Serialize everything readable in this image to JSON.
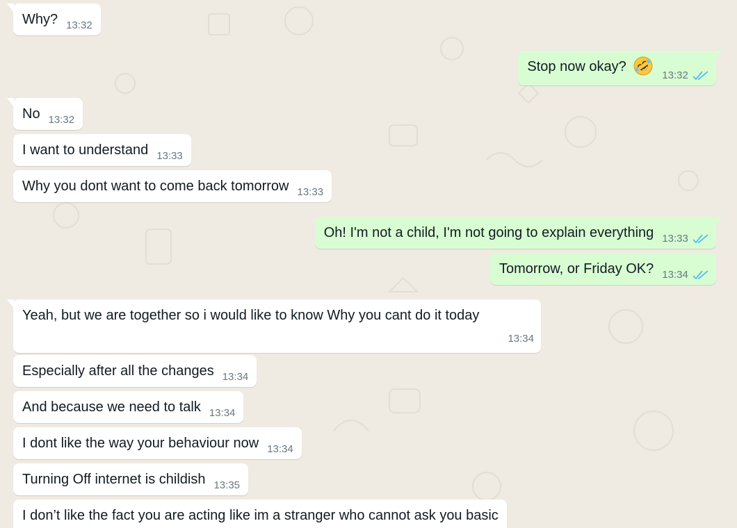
{
  "messages": [
    {
      "text": "Why?",
      "time": "13:32"
    },
    {
      "text": "Stop now okay?",
      "emoji": "rolling-on-floor-laughing-emoji",
      "time": "13:32"
    },
    {
      "text": "No",
      "time": "13:32"
    },
    {
      "text": "I want to understand",
      "time": "13:33"
    },
    {
      "text": "Why you dont want to come back tomorrow",
      "time": "13:33"
    },
    {
      "text": "Oh! I'm not a child, I'm not going to explain everything",
      "time": "13:33"
    },
    {
      "text": "Tomorrow, or Friday OK?",
      "time": "13:34"
    },
    {
      "text": "Yeah, but we are together so i would like to know Why you cant do it today",
      "time": "13:34"
    },
    {
      "text": "Especially after all the changes",
      "time": "13:34"
    },
    {
      "text": "And because we need to talk",
      "time": "13:34"
    },
    {
      "text": "I dont like the way your behaviour now",
      "time": "13:34"
    },
    {
      "text": "Turning Off internet is childish",
      "time": "13:35"
    },
    {
      "text": "I don’t like the fact you are acting like im a stranger who cannot ask you basic"
    }
  ],
  "colors": {
    "background": "#efeae2",
    "incoming_bubble": "#ffffff",
    "outgoing_bubble": "#d9fdd3",
    "read_ticks": "#53bdeb",
    "timestamp": "#667781"
  },
  "icons": {
    "read_receipt": "double-check-icon"
  }
}
